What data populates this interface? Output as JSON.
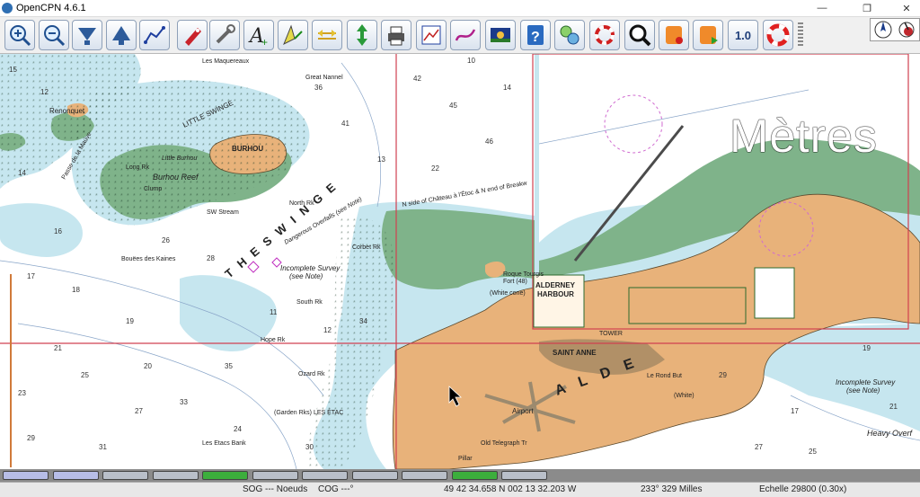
{
  "window": {
    "title": "OpenCPN 4.6.1"
  },
  "toolbar": {
    "tools": [
      {
        "name": "zoom-in-tool",
        "icon": "zoom-in-icon"
      },
      {
        "name": "zoom-out-tool",
        "icon": "zoom-out-icon"
      },
      {
        "name": "scale-in-tool",
        "icon": "scale-down-icon"
      },
      {
        "name": "scale-out-tool",
        "icon": "scale-up-icon"
      },
      {
        "name": "route-tool",
        "icon": "route-icon"
      },
      {
        "name": "auto-follow-tool",
        "icon": "ship-icon"
      },
      {
        "name": "settings-tool",
        "icon": "wrench-icon"
      },
      {
        "name": "text-tool",
        "icon": "text-icon"
      },
      {
        "name": "current-tool",
        "icon": "current-icon"
      },
      {
        "name": "tide-tool",
        "icon": "tide-icon"
      },
      {
        "name": "track-tool",
        "icon": "arrows-icon"
      },
      {
        "name": "print-tool",
        "icon": "printer-icon"
      },
      {
        "name": "route-manager-tool",
        "icon": "route-manager-icon"
      },
      {
        "name": "track-manager-tool",
        "icon": "track-icon"
      },
      {
        "name": "color-scheme-tool",
        "icon": "scheme-icon"
      },
      {
        "name": "help-tool",
        "icon": "help-icon"
      },
      {
        "name": "ais-tool",
        "icon": "ais-icon"
      },
      {
        "name": "mob-tool",
        "icon": "mob-icon"
      },
      {
        "name": "find-tool",
        "icon": "magnifier-icon"
      },
      {
        "name": "record-tool",
        "icon": "record-icon"
      },
      {
        "name": "play-tool",
        "icon": "play-icon"
      },
      {
        "name": "scale-tool",
        "icon": "scale-text-icon",
        "label": "1.0"
      },
      {
        "name": "lifebuoy-tool",
        "icon": "lifebuoy-icon"
      }
    ]
  },
  "overlay": {
    "units_text": "Mètres"
  },
  "chart": {
    "labels": {
      "alderney_harbour_1": "ALDERNEY",
      "alderney_harbour_2": "HARBOUR",
      "saint_anne": "SAINT ANNE",
      "burhou": "BURHOU",
      "burhou_reef": "Burhou Reef",
      "little_burhou": "Little Burhou",
      "swinge": "T H E   S W I N G E",
      "little_swinge": "LITTLE  SWINGE",
      "dangerous_overfalls": "Dangerous Overfalls (see Note)",
      "incomplete_survey_1": "Incomplete Survey",
      "incomplete_survey_2": "(see Note)",
      "incomplete_survey_right": "Incomplete Survey",
      "incomplete_survey_right_2": "(see Note)",
      "heavy_overfalls": "Heavy Overf",
      "airport": "Airport",
      "alde": "A L D E",
      "tower": "TOWER",
      "le_rond_but": "Le Rond But",
      "old_telegraph": "Old Telegraph Tr",
      "pillar": "Pillar",
      "fort": "Fort (48)",
      "roque_tourgis": "Roque Tourgis",
      "white_cone": "(White cone)",
      "north_rk": "North Rk",
      "south_rk": "South Rk",
      "corbet_rk": "Corbet Rk",
      "hope_rk": "Hope Rk",
      "ozard_rk": "Ozard Rk",
      "les_etacs": "Les Etacs Bank",
      "bouees_des_kaines": "Bouëes des Kaines",
      "garden_rks": "(Garden Rks) LES ÉTAC",
      "les_maquereaux": "Les Maquereaux",
      "renonquet": "Renonquet",
      "great_nannel": "Great Nannel",
      "chateau": "N side of Château à l'Étoc & N end of Breakw",
      "clump": "Clump",
      "long_rk": "Long Rk",
      "sw_stream": "SW Stream",
      "passe": "Passe de la Mauve",
      "white_beacon": "(White)"
    },
    "soundings": [
      "15",
      "12",
      "14",
      "16",
      "17",
      "18",
      "19",
      "21",
      "23",
      "25",
      "27",
      "29",
      "31",
      "33",
      "35",
      "36",
      "41",
      "42",
      "45",
      "46",
      "13",
      "22",
      "26",
      "28",
      "20",
      "24",
      "30",
      "34",
      "12",
      "11",
      "10",
      "14",
      "17",
      "19",
      "27",
      "25",
      "21",
      "29"
    ]
  },
  "piano": {
    "keys": [
      {
        "color": "#b7bde7"
      },
      {
        "color": "#b7bde7"
      },
      {
        "color": "#b9bfc9"
      },
      {
        "color": "#b9bfc9"
      },
      {
        "color": "#3cae3c"
      },
      {
        "color": "#b9bfc9"
      },
      {
        "color": "#b9bfc9"
      },
      {
        "color": "#b9bfc9"
      },
      {
        "color": "#b9bfc9"
      },
      {
        "color": "#3cae3c"
      },
      {
        "color": "#b9bfc9"
      }
    ]
  },
  "status": {
    "sog": "SOG --- Noeuds",
    "cog": "COG ---°",
    "position": "49 42 34.658 N    002 13 32.203 W",
    "bearing": "233°  329 Milles",
    "scale": "Echelle 29800 (0.30x)"
  },
  "colors": {
    "land": "#e8b27a",
    "intertidal": "#7fb38a",
    "shallow": "#c6e6ef",
    "deep": "#ffffff",
    "chart_border": "#d04050"
  }
}
